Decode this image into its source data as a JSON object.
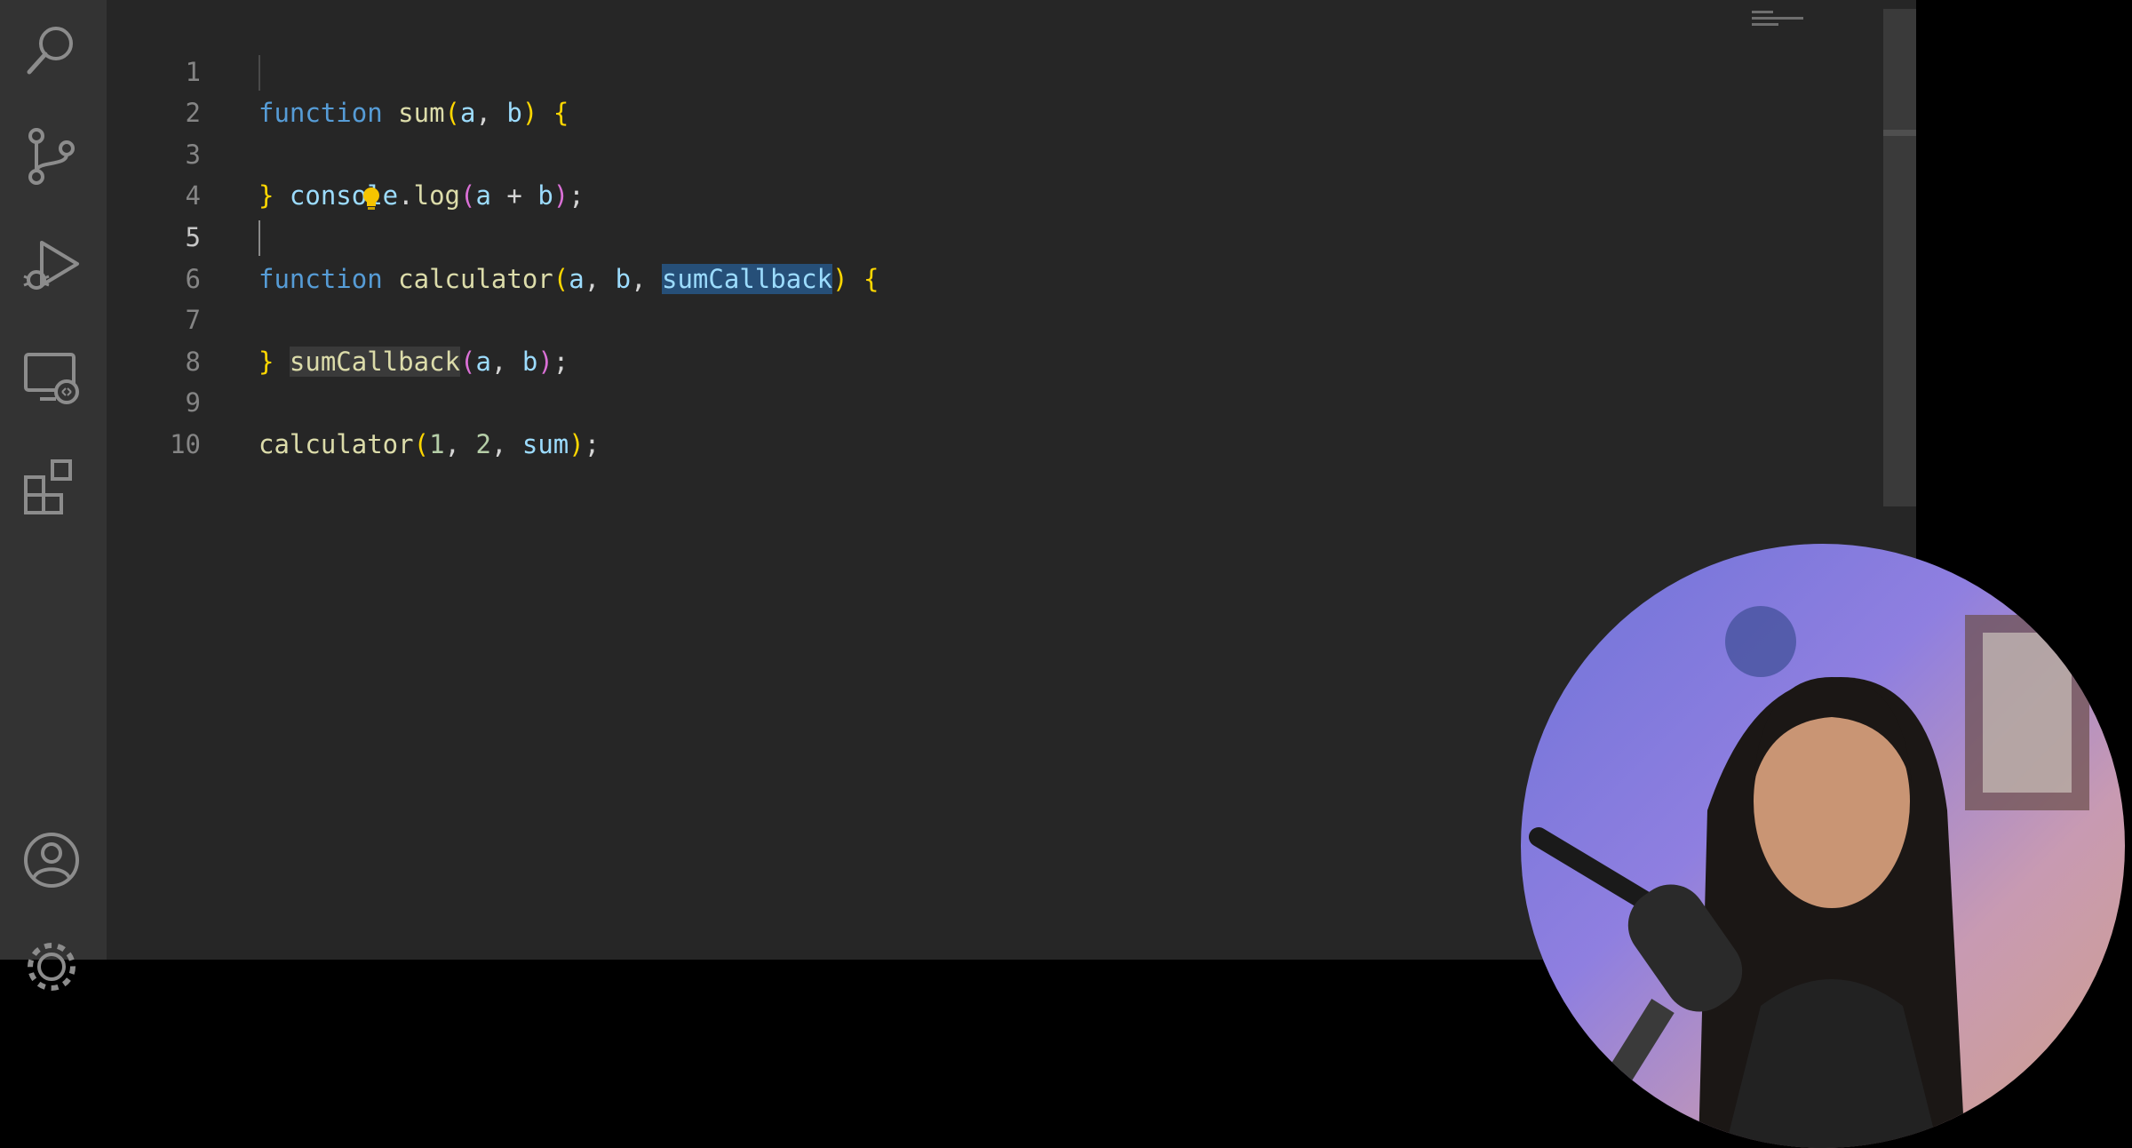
{
  "activity_bar": {
    "icons": [
      "search-icon",
      "source-control-icon",
      "run-debug-icon",
      "remote-explorer-icon",
      "extensions-icon",
      "account-icon",
      "settings-gear-icon"
    ]
  },
  "editor": {
    "active_line": 5,
    "lines": [
      {
        "number": "1",
        "text": "function sum(a, b) {"
      },
      {
        "number": "2",
        "text": "  console.log(a + b);"
      },
      {
        "number": "3",
        "text": "}"
      },
      {
        "number": "4",
        "text": ""
      },
      {
        "number": "5",
        "text": "function calculator(a, b, sumCallback) {"
      },
      {
        "number": "6",
        "text": "  sumCallback(a, b);"
      },
      {
        "number": "7",
        "text": "}"
      },
      {
        "number": "8",
        "text": ""
      },
      {
        "number": "9",
        "text": "calculator(1, 2, sum);"
      },
      {
        "number": "10",
        "text": ""
      }
    ],
    "tokens": {
      "l1": [
        "function",
        "sum",
        "(",
        "a",
        ", ",
        "b",
        ")",
        " ",
        "{"
      ],
      "l2": [
        "console",
        ".",
        "log",
        "(",
        "a",
        " + ",
        "b",
        ")",
        ";"
      ],
      "l3": [
        "}"
      ],
      "l5": [
        "function",
        "calculator",
        "(",
        "a",
        ", ",
        "b",
        ", ",
        "sumCallback",
        ")",
        " ",
        "{"
      ],
      "l6": [
        "sumCallback",
        "(",
        "a",
        ", ",
        "b",
        ")",
        ";"
      ],
      "l7": [
        "}"
      ],
      "l9": [
        "calculator",
        "(",
        "1",
        ", ",
        "2",
        ", ",
        "sum",
        ")",
        ";"
      ]
    },
    "selected_text": "sumCallback",
    "lightbulb_icon": "lightbulb-icon"
  },
  "colors": {
    "editor_bg": "#262626",
    "activity_bar_bg": "#333333",
    "keyword": "#569cd6",
    "function": "#dcdcaa",
    "bracket_level1": "#ffd700",
    "bracket_level2": "#da70d6",
    "selection": "#264f78"
  }
}
